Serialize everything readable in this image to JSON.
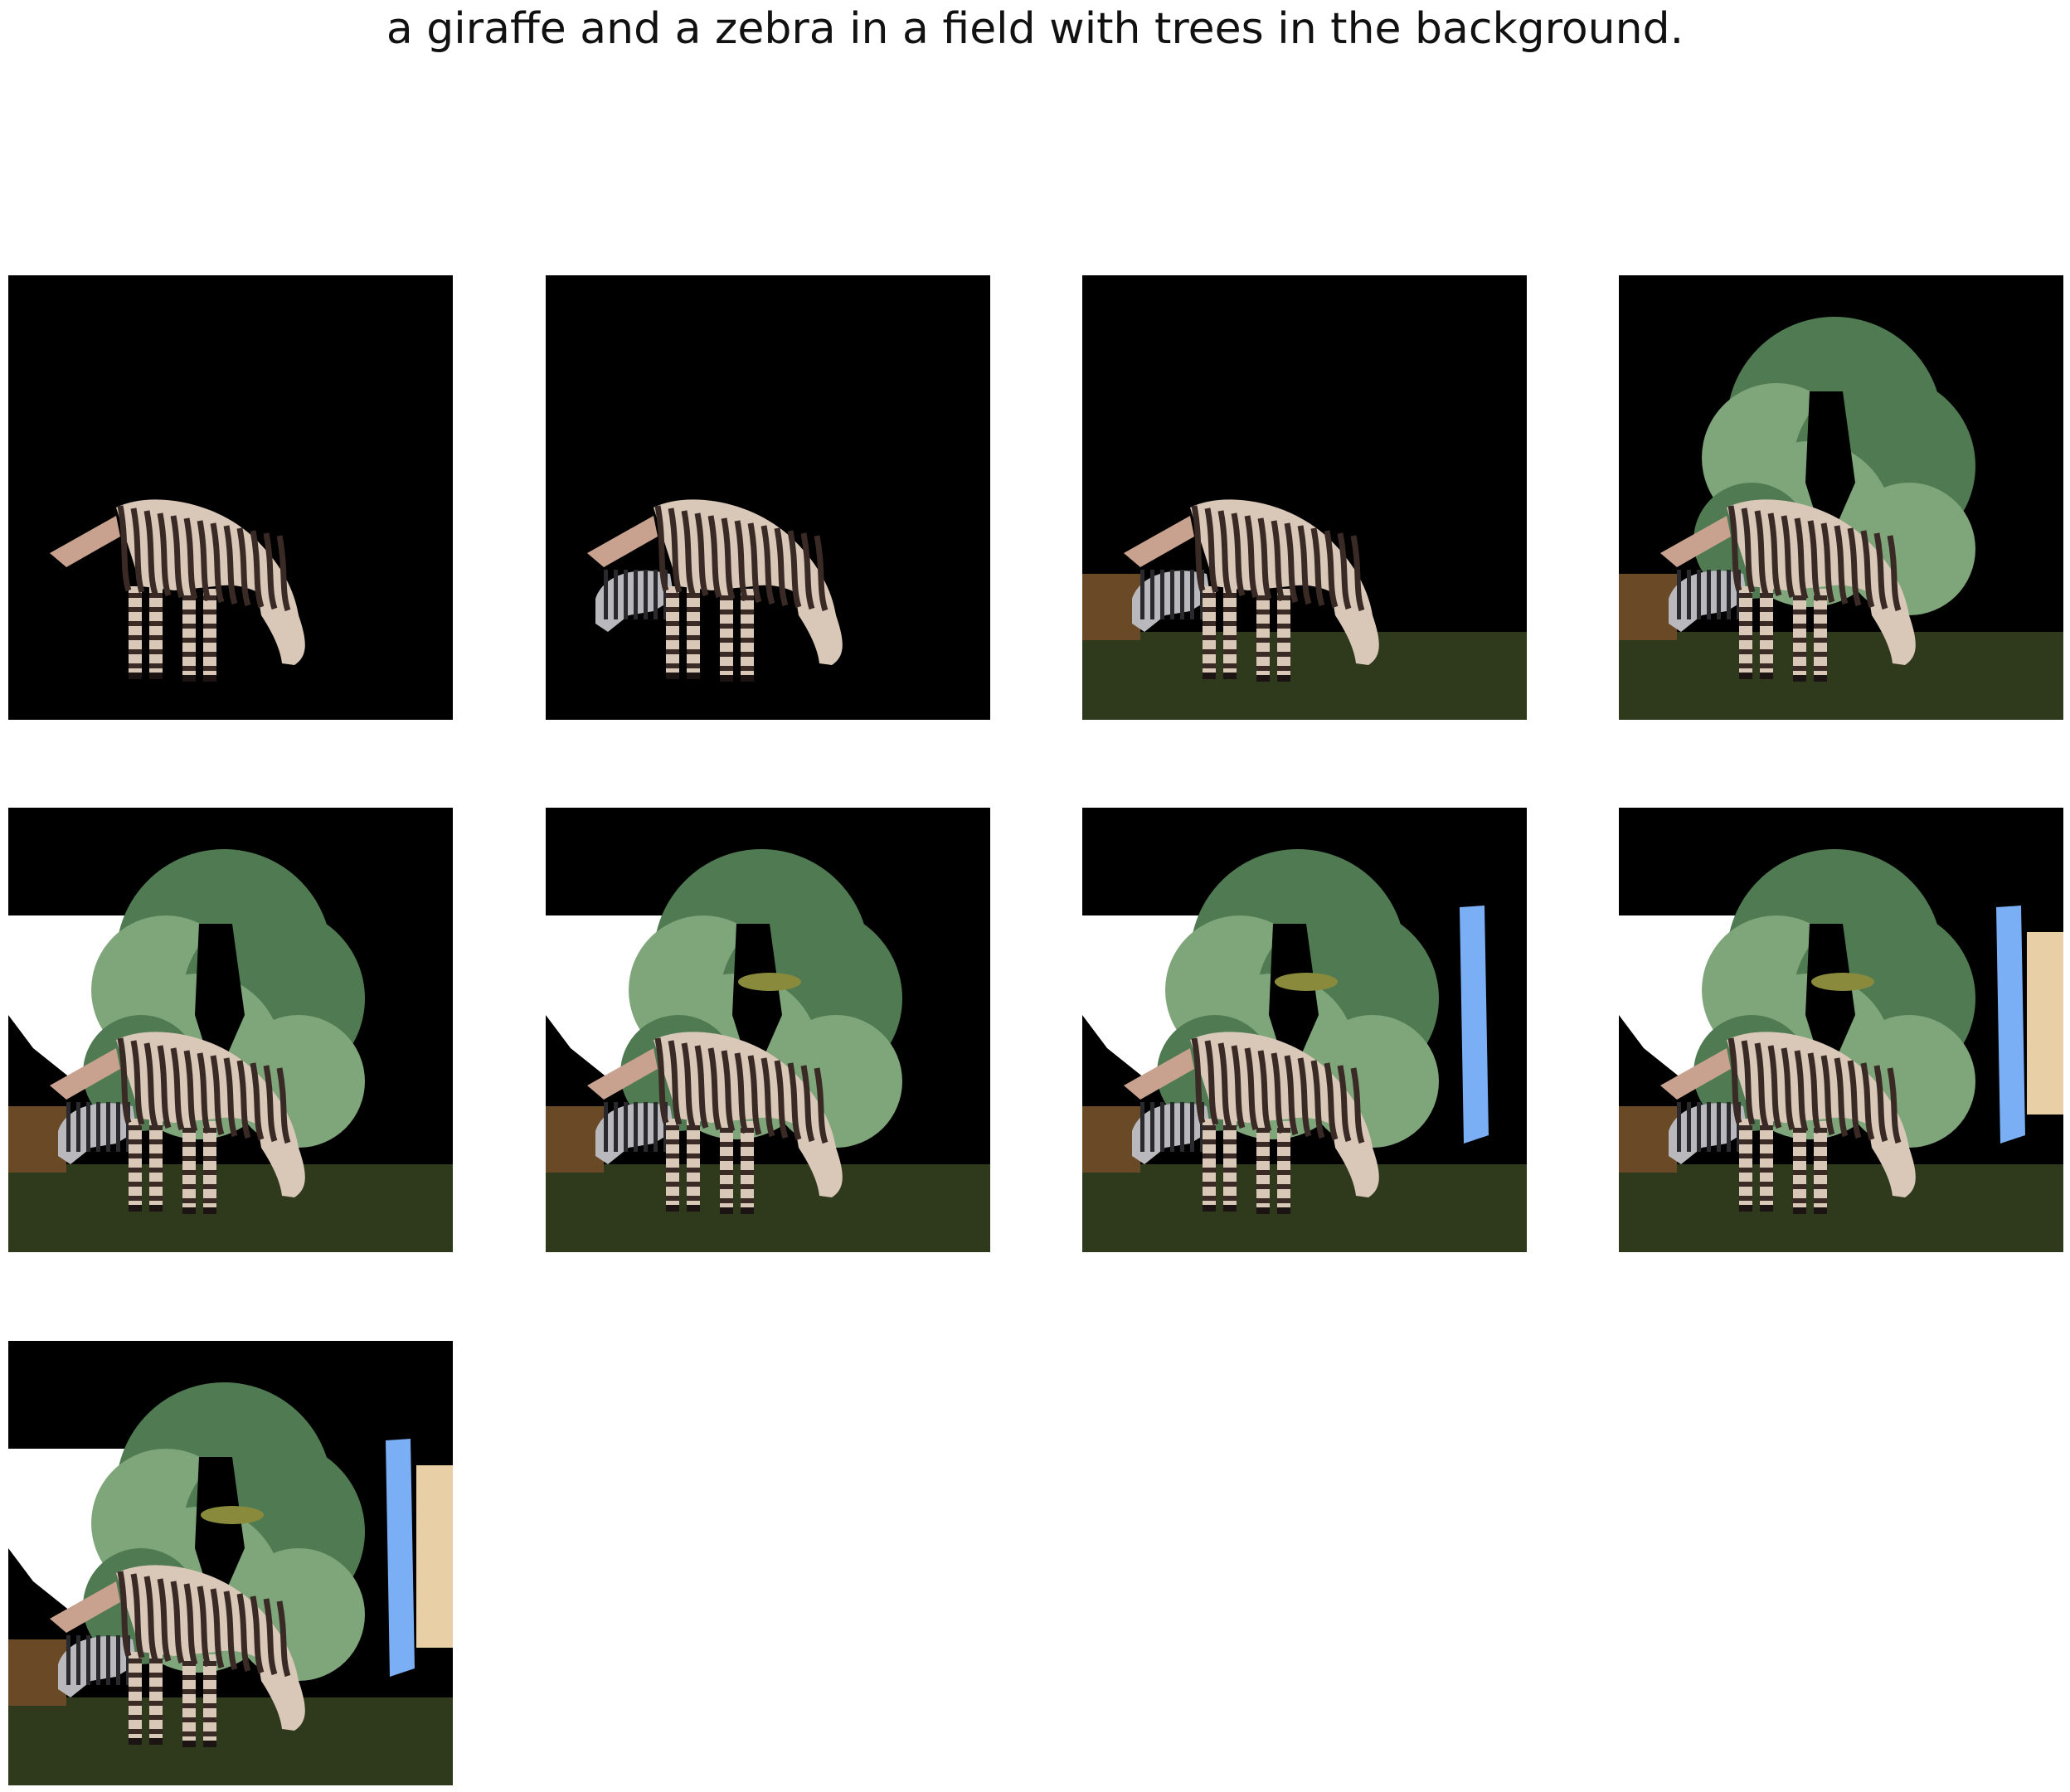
{
  "caption": "a giraffe and a zebra in a field with trees in the background.",
  "panels": [
    {
      "step": 1,
      "ground": false,
      "tree": false,
      "white_sky": false,
      "small_zebra": false,
      "bird": false,
      "blue_bar": false,
      "beige": false
    },
    {
      "step": 2,
      "ground": false,
      "tree": false,
      "white_sky": false,
      "small_zebra": true,
      "bird": false,
      "blue_bar": false,
      "beige": false
    },
    {
      "step": 3,
      "ground": true,
      "tree": false,
      "white_sky": false,
      "small_zebra": true,
      "bird": false,
      "blue_bar": false,
      "beige": false
    },
    {
      "step": 4,
      "ground": true,
      "tree": true,
      "white_sky": false,
      "small_zebra": true,
      "bird": false,
      "blue_bar": false,
      "beige": false
    },
    {
      "step": 5,
      "ground": true,
      "tree": true,
      "white_sky": true,
      "small_zebra": true,
      "bird": false,
      "blue_bar": false,
      "beige": false
    },
    {
      "step": 6,
      "ground": true,
      "tree": true,
      "white_sky": true,
      "small_zebra": true,
      "bird": true,
      "blue_bar": false,
      "beige": false
    },
    {
      "step": 7,
      "ground": true,
      "tree": true,
      "white_sky": true,
      "small_zebra": true,
      "bird": true,
      "blue_bar": true,
      "beige": false
    },
    {
      "step": 8,
      "ground": true,
      "tree": true,
      "white_sky": true,
      "small_zebra": true,
      "bird": true,
      "blue_bar": true,
      "beige": true
    },
    {
      "step": 9,
      "ground": true,
      "tree": true,
      "white_sky": true,
      "small_zebra": true,
      "bird": true,
      "blue_bar": true,
      "beige": true
    }
  ],
  "colors": {
    "background": "#000000",
    "tree": "#4f7a52",
    "tree_light": "#7fa57a",
    "ground": "#2f3a1c",
    "dirt": "#6a4a26",
    "sky": "#ffffff",
    "blue_bar": "#7aaef5",
    "beige": "#e8cfa6",
    "zebra_light": "#d9c7b8",
    "zebra_dark": "#3a2a26"
  }
}
